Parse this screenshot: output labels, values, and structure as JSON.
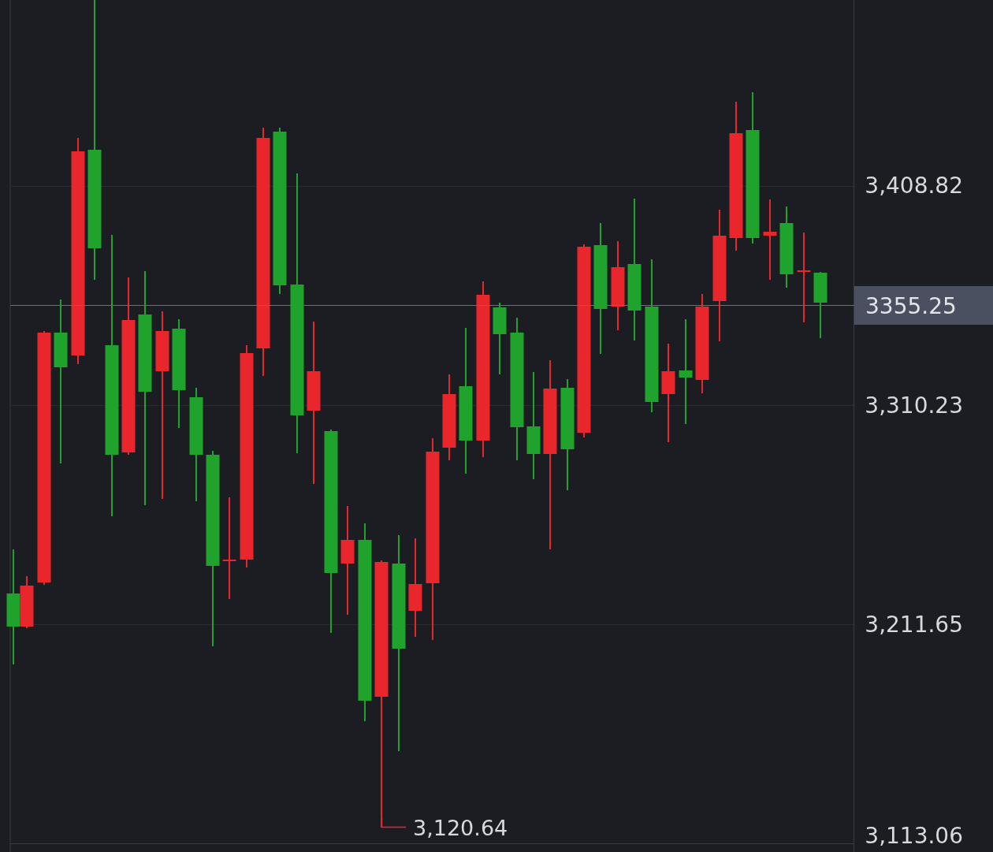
{
  "chart": {
    "price_axis": {
      "labels": [
        "3,408.82",
        "3,310.23",
        "3,211.65",
        "3,113.06"
      ]
    },
    "current_price": {
      "label": "3355.25"
    },
    "low_marker": {
      "label": "3,120.64"
    }
  }
}
